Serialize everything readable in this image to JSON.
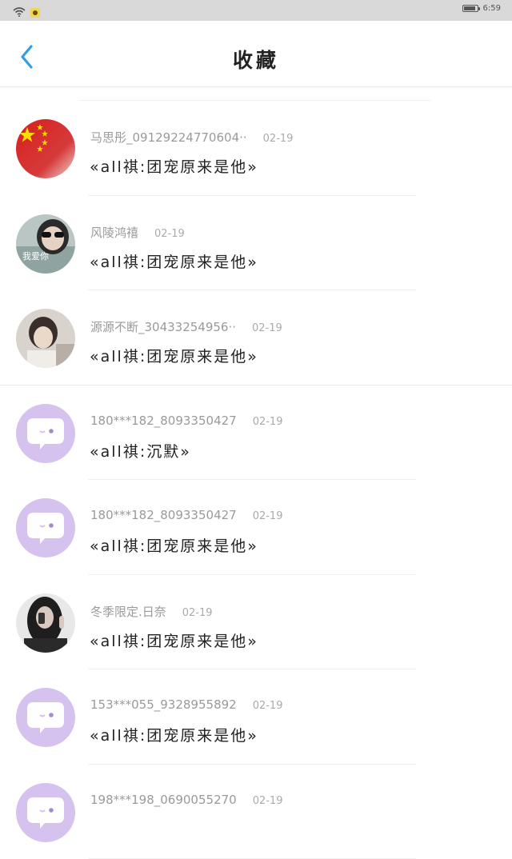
{
  "status_bar": {
    "time": "6:59"
  },
  "header": {
    "title": "收藏"
  },
  "items": [
    {
      "name": "马思彤_09129224770604··",
      "date": "02-19",
      "content": "«all祺:团宠原来是他»",
      "avatar": "flag"
    },
    {
      "name": "风陵鸿禧",
      "date": "02-19",
      "content": "«all祺:团宠原来是他»",
      "avatar": "photo",
      "avatar_text": "我爱你"
    },
    {
      "name": "源源不断_30433254956··",
      "date": "02-19",
      "content": "«all祺:团宠原来是他»",
      "avatar": "photo"
    },
    {
      "name": "180***182_8093350427",
      "date": "02-19",
      "content": "«all祺:沉默»",
      "avatar": "default"
    },
    {
      "name": "180***182_8093350427",
      "date": "02-19",
      "content": "«all祺:团宠原来是他»",
      "avatar": "default"
    },
    {
      "name": "冬季限定.日奈",
      "date": "02-19",
      "content": "«all祺:团宠原来是他»",
      "avatar": "photo"
    },
    {
      "name": "153***055_9328955892",
      "date": "02-19",
      "content": "«all祺:团宠原来是他»",
      "avatar": "default"
    },
    {
      "name": "198***198_0690055270",
      "date": "02-19",
      "content": "",
      "avatar": "default"
    }
  ]
}
